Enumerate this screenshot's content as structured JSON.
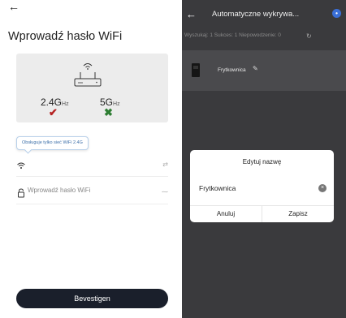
{
  "left": {
    "back_icon": "arrow-left",
    "title": "Wprowadź hasło WiFi",
    "bands": [
      {
        "label": "2.4G",
        "unit": "Hz",
        "supported": true
      },
      {
        "label": "5G",
        "unit": "Hz",
        "supported": false
      }
    ],
    "tooltip": "Obsługuje tylko sieć WiFi 2.4G",
    "password_placeholder": "Wprowadź hasło WiFi",
    "confirm_label": "Bevestigen"
  },
  "right": {
    "title": "Automatyczne wykrywa...",
    "status": "Wyszukaj: 1  Sukces: 1  Niepowodzenie: 0",
    "device_name": "Frytkownica",
    "dialog": {
      "title": "Edytuj nazwę",
      "input_value": "Frytkownica",
      "cancel_label": "Anuluj",
      "save_label": "Zapisz"
    }
  },
  "colors": {
    "confirm_button": "#1a1f2b",
    "check": "#b52222",
    "cross": "#2d7d32",
    "overlay_bg": "#3a3a3d",
    "info_icon": "#3a6fd8"
  }
}
